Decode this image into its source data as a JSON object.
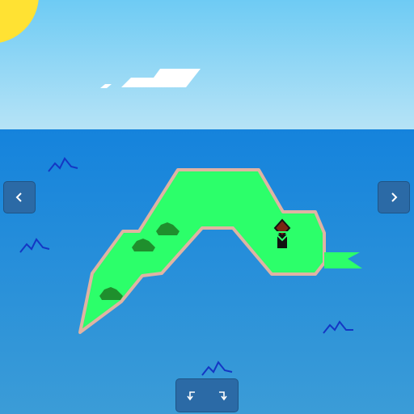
{
  "colors": {
    "sky_top": "#6ecbf4",
    "sky_bottom": "#b6e3f6",
    "sea_top": "#1583dc",
    "sea_bottom": "#3b9cd7",
    "sun": "#ffe233",
    "island": "#2cff6a",
    "beach": "#e0b3a3",
    "tree": "#1f8f2d",
    "wave": "#1437c4",
    "player_body": "#111111",
    "player_head": "#7a2412",
    "button": "#2b6aa6"
  },
  "controls": {
    "left_icon": "chevron-left-icon",
    "right_icon": "chevron-right-icon",
    "rotate_ccw_icon": "rotate-ccw-icon",
    "rotate_cw_icon": "rotate-cw-icon"
  }
}
